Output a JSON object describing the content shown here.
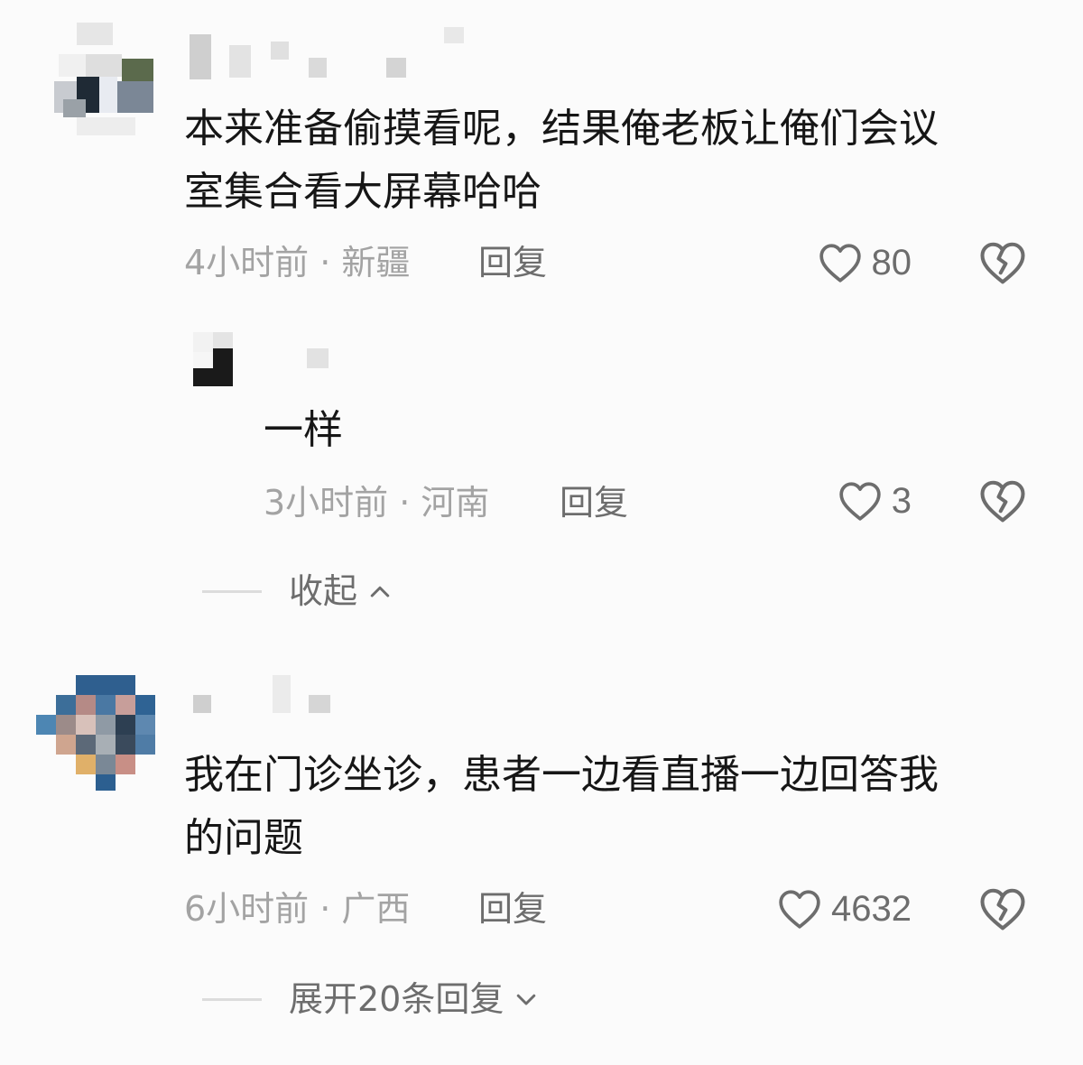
{
  "comments": [
    {
      "text": "本来准备偷摸看呢，结果俺老板让俺们会议\n室集合看大屏幕哈哈",
      "meta": "4小时前 · 新疆",
      "reply_label": "回复",
      "likes": "80",
      "avatar": "pixelated-avatar-icon"
    },
    {
      "text": "我在门诊坐诊，患者一边看直播一边回答我\n的问题",
      "meta": "6小时前 · 广西",
      "reply_label": "回复",
      "likes": "4632",
      "avatar": "pixelated-avatar-icon"
    }
  ],
  "reply": {
    "text": "一样",
    "meta": "3小时前 · 河南",
    "reply_label": "回复",
    "likes": "3",
    "avatar": "pixelated-avatar-icon"
  },
  "collapse_label": "收起",
  "expand_label": "展开20条回复",
  "icons": {
    "like": "heart-outline-icon",
    "dislike": "broken-heart-icon",
    "collapse": "chevron-up-icon",
    "expand": "chevron-down-icon"
  },
  "colors": {
    "background": "#fbfbfb",
    "text": "#161616",
    "meta": "#a3a3a3",
    "secondary": "#6d6d6d"
  }
}
